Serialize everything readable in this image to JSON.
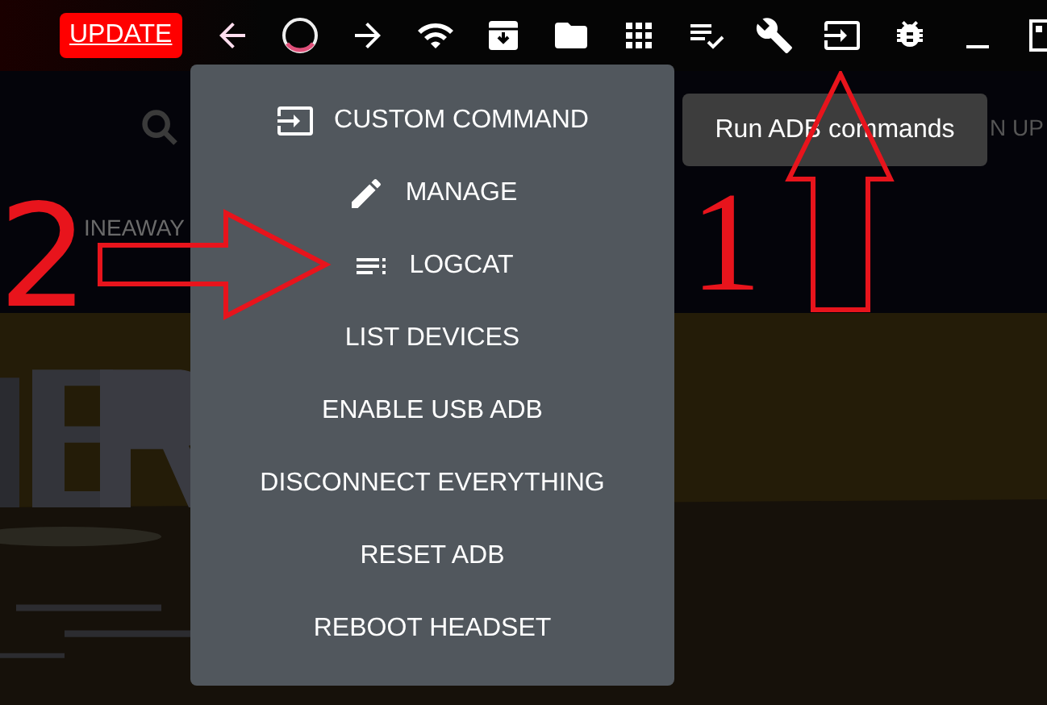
{
  "toolbar": {
    "update_button": "UPDATE"
  },
  "background": {
    "giveaway_text": "INEAWAY",
    "signup_text": "N UP"
  },
  "menu": {
    "items": [
      {
        "label": "CUSTOM COMMAND"
      },
      {
        "label": "MANAGE"
      },
      {
        "label": "LOGCAT"
      },
      {
        "label": "LIST DEVICES"
      },
      {
        "label": "ENABLE USB ADB"
      },
      {
        "label": "DISCONNECT EVERYTHING"
      },
      {
        "label": "RESET ADB"
      },
      {
        "label": "REBOOT HEADSET"
      }
    ]
  },
  "tooltip": "Run ADB commands",
  "annotations": [
    {
      "number": "2",
      "kind": "right"
    },
    {
      "number": "1",
      "kind": "up"
    }
  ]
}
